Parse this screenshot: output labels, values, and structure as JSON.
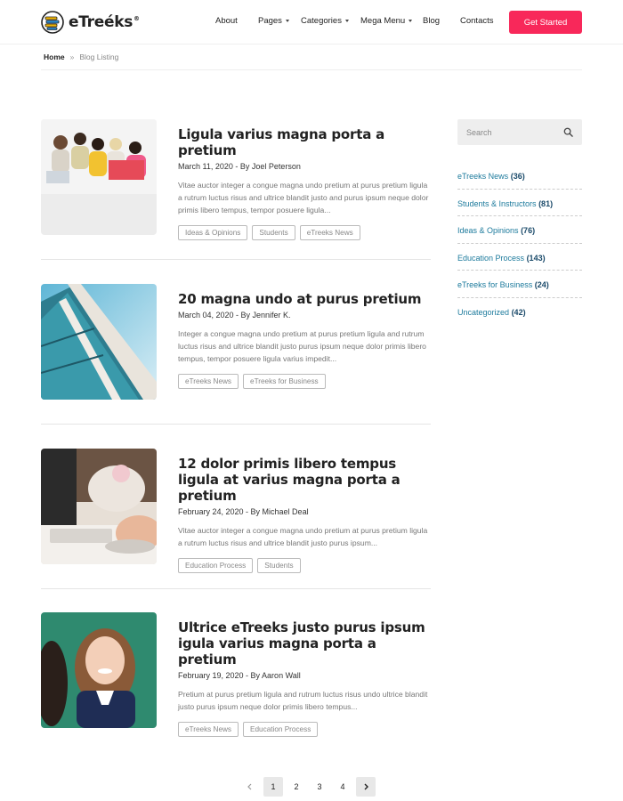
{
  "header": {
    "logo_text": "eTreéks",
    "logo_reg": "®",
    "nav": [
      {
        "label": "About",
        "has_caret": false
      },
      {
        "label": "Pages",
        "has_caret": true
      },
      {
        "label": "Categories",
        "has_caret": true
      },
      {
        "label": "Mega Menu",
        "has_caret": true
      },
      {
        "label": "Blog",
        "has_caret": false
      },
      {
        "label": "Contacts",
        "has_caret": false
      }
    ],
    "cta_label": "Get Started",
    "accent_color": "#f8285a"
  },
  "breadcrumb": {
    "home": "Home",
    "separator": "»",
    "current": "Blog Listing"
  },
  "posts": [
    {
      "title": "Ligula varius magna porta a pretium",
      "meta": "March 11, 2020 - By Joel Peterson",
      "excerpt": "Vitae auctor integer a congue magna undo pretium at purus pretium ligula a rutrum luctus risus and ultrice blandit justo and purus ipsum neque dolor primis libero tempus, tempor posuere ligula...",
      "tags": [
        "Ideas & Opinions",
        "Students",
        "eTreeks News"
      ],
      "image": "students-group-photo"
    },
    {
      "title": "20 magna undo at purus pretium",
      "meta": "March 04, 2020 - By Jennifer K.",
      "excerpt": "Integer a congue magna undo pretium at purus pretium ligula and rutrum luctus risus and ultrice blandit justo purus ipsum neque dolor primis libero tempus, tempor posuere ligula varius impedit...",
      "tags": [
        "eTreeks News",
        "eTreeks for Business"
      ],
      "image": "building-photo"
    },
    {
      "title": "12 dolor primis libero tempus ligula at varius magna porta a pretium",
      "meta": "February 24, 2020 - By Michael Deal",
      "excerpt": "Vitae auctor integer a congue magna undo pretium at purus pretium ligula a rutrum luctus risus and ultrice blandit justo purus ipsum...",
      "tags": [
        "Education Process",
        "Students"
      ],
      "image": "laptop-photo"
    },
    {
      "title": "Ultrice eTreeks justo purus ipsum igula varius magna porta a pretium",
      "meta": "February 19, 2020 - By Aaron Wall",
      "excerpt": "Pretium at purus pretium ligula and rutrum luctus risus undo ultrice blandit justo purus ipsum neque dolor primis libero tempus...",
      "tags": [
        "eTreeks News",
        "Education Process"
      ],
      "image": "student-girl-photo"
    }
  ],
  "sidebar": {
    "search_placeholder": "Search",
    "categories": [
      {
        "label": "eTreeks News",
        "count": "(36)"
      },
      {
        "label": "Students & Instructors",
        "count": "(81)"
      },
      {
        "label": "Ideas & Opinions",
        "count": "(76)"
      },
      {
        "label": "Education Process",
        "count": "(143)"
      },
      {
        "label": "eTreeks for Business",
        "count": "(24)"
      },
      {
        "label": "Uncategorized",
        "count": "(42)"
      }
    ],
    "link_color": "#1c7a9c"
  },
  "pagination": {
    "pages": [
      "1",
      "2",
      "3",
      "4"
    ],
    "current": "1",
    "prev_icon": "chevron-left-icon",
    "next_icon": "chevron-right-icon"
  }
}
